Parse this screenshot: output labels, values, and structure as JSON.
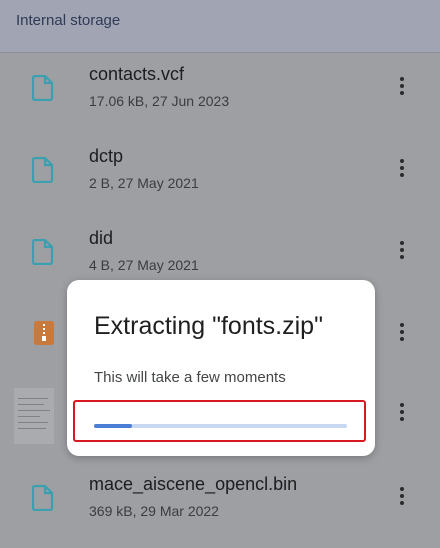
{
  "header": {
    "title": "Internal storage"
  },
  "files": [
    {
      "name": "contacts.vcf",
      "meta": "17.06 kB, 27 Jun 2023",
      "icon": "document-icon"
    },
    {
      "name": "dctp",
      "meta": "2 B, 27 May 2021",
      "icon": "document-icon"
    },
    {
      "name": "did",
      "meta": "4 B, 27 May 2021",
      "icon": "document-icon"
    },
    {
      "name": "",
      "meta": "",
      "icon": "zip-archive-icon"
    },
    {
      "name": "",
      "meta": "",
      "icon": "image-thumbnail"
    },
    {
      "name": "mace_aiscene_opencl.bin",
      "meta": "369 kB, 29 Mar 2022",
      "icon": "document-icon"
    }
  ],
  "dialog": {
    "title": "Extracting \"fonts.zip\"",
    "message": "This will take a few moments",
    "progress": 0.15
  },
  "colors": {
    "accent": "#4b7fd4",
    "progress_track": "#c8d8f2",
    "file_icon": "#3aa0b0",
    "zip_icon": "#c87a3c",
    "highlight": "#d71920"
  }
}
